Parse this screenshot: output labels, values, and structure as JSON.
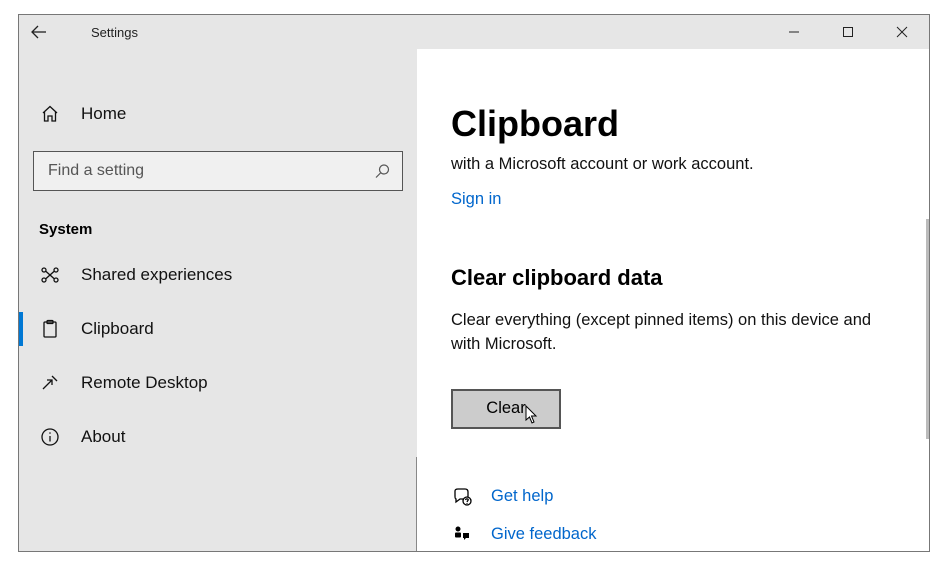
{
  "window": {
    "title": "Settings"
  },
  "sidebar": {
    "search_placeholder": "Find a setting",
    "home_label": "Home",
    "category": "System",
    "items": [
      {
        "label": "Shared experiences"
      },
      {
        "label": "Clipboard"
      },
      {
        "label": "Remote Desktop"
      },
      {
        "label": "About"
      }
    ]
  },
  "main": {
    "title": "Clipboard",
    "account_line": "with a Microsoft account or work account.",
    "signin_label": "Sign in",
    "section_heading": "Clear clipboard data",
    "section_body": "Clear everything (except pinned items) on this device and with Microsoft.",
    "clear_button": "Clear",
    "help_label": "Get help",
    "feedback_label": "Give feedback"
  }
}
